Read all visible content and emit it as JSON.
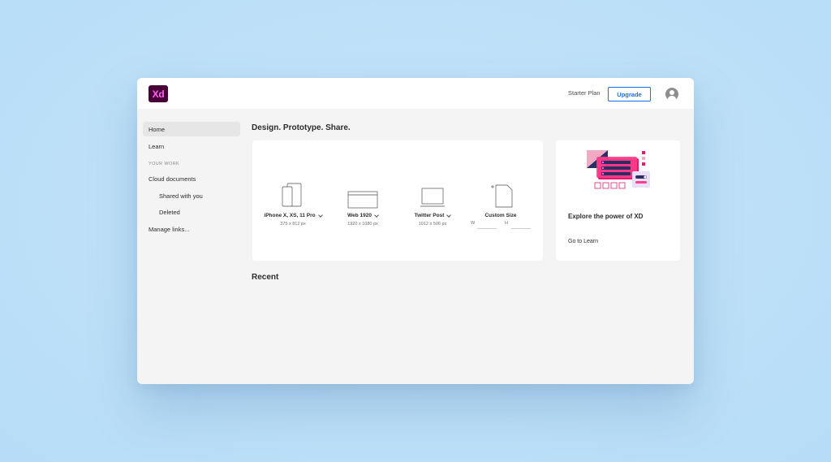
{
  "app": {
    "logo_text": "Xd",
    "brand_color": "#ff61f6",
    "brand_bg": "#470137"
  },
  "header": {
    "plan_label": "Starter Plan",
    "upgrade_label": "Upgrade",
    "accent": "#1473e6"
  },
  "sidebar": {
    "items": [
      {
        "label": "Home",
        "active": true
      },
      {
        "label": "Learn"
      },
      {
        "label": "Cloud documents"
      },
      {
        "label": "Shared with you"
      },
      {
        "label": "Deleted"
      },
      {
        "label": "Manage links..."
      }
    ],
    "section_label": "YOUR WORK"
  },
  "main": {
    "heading": "Design. Prototype. Share.",
    "recent_heading": "Recent",
    "presets": [
      {
        "name": "iPhone X, XS, 11 Pro",
        "size": "375 x 812 px",
        "icon": "phone-icon"
      },
      {
        "name": "Web 1920",
        "size": "1920 x 1080 px",
        "icon": "browser-icon"
      },
      {
        "name": "Twitter Post",
        "size": "1012 x 506 px",
        "icon": "tablet-icon"
      },
      {
        "name": "Custom Size",
        "w_label": "W",
        "h_label": "H",
        "icon": "custom-size-icon"
      }
    ],
    "learn_card": {
      "title": "Explore the power of XD",
      "link": "Go to Learn"
    }
  }
}
